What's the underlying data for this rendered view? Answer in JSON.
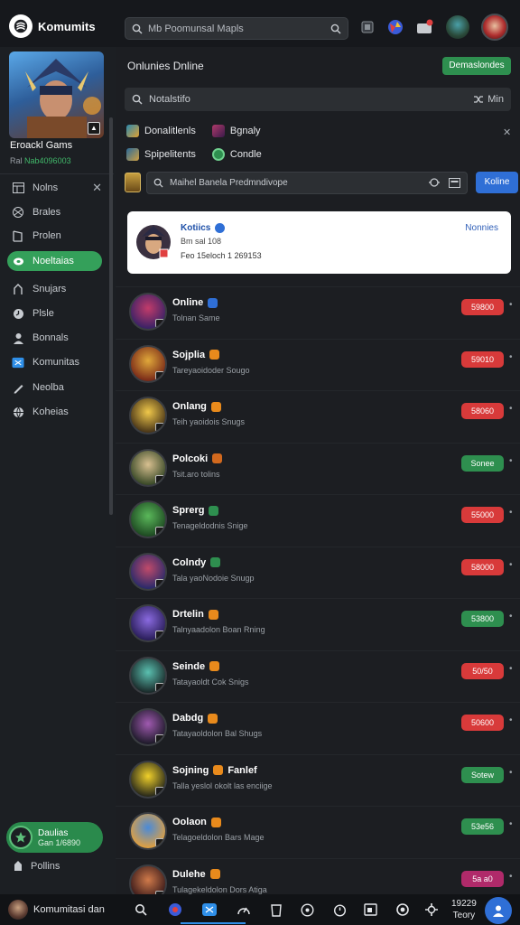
{
  "app": {
    "title": "Komumits"
  },
  "search": {
    "placeholder": "Mb Poomunsal Mapls"
  },
  "sidebar": {
    "hero_name": "Eroackl Gams",
    "hero_sub_prefix": "Ral",
    "hero_sub_value": "Nab4096003",
    "items": [
      {
        "label": "Nolns",
        "icon": "table-icon",
        "active": false
      },
      {
        "label": "Brales",
        "icon": "network-icon",
        "active": false
      },
      {
        "label": "Prolen",
        "icon": "book-icon",
        "active": false
      },
      {
        "label": "Noeltaias",
        "icon": "leaf-icon",
        "active": true
      },
      {
        "label": "Snujars",
        "icon": "person-icon",
        "active": false
      },
      {
        "label": "Plsle",
        "icon": "clock-icon",
        "active": false
      },
      {
        "label": "Bonnals",
        "icon": "user-icon",
        "active": false
      },
      {
        "label": "Komunitas",
        "icon": "message-icon",
        "active": false
      },
      {
        "label": "Neolba",
        "icon": "pen-icon",
        "active": false
      },
      {
        "label": "Koheias",
        "icon": "globe-icon",
        "active": false
      }
    ],
    "friend": {
      "name": "Daulias",
      "sub": "Gan 1/6890"
    },
    "profile_label": "Pollins"
  },
  "main": {
    "title": "Onlunies Dnline",
    "action_button": "Demaslondes",
    "search_placeholder": "Notalstifo",
    "search_right_label": "Min",
    "filters": [
      {
        "left": "Donalitlenls",
        "right": "Bgnaly"
      },
      {
        "left": "Spipelitents",
        "right": "Condle"
      }
    ],
    "map_input_placeholder": "Maihel Banela Predmndivope",
    "map_button": "Koline",
    "profile_card": {
      "name": "Kotiics",
      "line2": "Bm sal 108",
      "line3": "Feo 15eloch 1 269153",
      "link": "Nonnies"
    },
    "rows": [
      {
        "name": "Online",
        "sub": "Tolnan Same",
        "pill": "59800",
        "pill_color": "#d83a3a",
        "badge_color": "#2f6fd6",
        "avatar_colors": [
          "#c23b6a",
          "#3a2266"
        ]
      },
      {
        "name": "Sojplia",
        "sub": "Tareyaoidoder Sougo",
        "pill": "59010",
        "pill_color": "#d83a3a",
        "badge_color": "#e88a1c",
        "avatar_colors": [
          "#e0a83a",
          "#7a2a18"
        ]
      },
      {
        "name": "Onlang",
        "sub": "Teih yaoidois Snugs",
        "pill": "58060",
        "pill_color": "#d83a3a",
        "badge_color": "#e88a1c",
        "avatar_colors": [
          "#f0c84a",
          "#4a3618"
        ]
      },
      {
        "name": "Polcoki",
        "sub": "Tsit.aro tolins",
        "pill": "Sonee",
        "pill_color": "#2e8f4f",
        "badge_color": "#d2691e",
        "avatar_colors": [
          "#d8c090",
          "#3a4a28"
        ]
      },
      {
        "name": "Sprerg",
        "sub": "Tenageldodnis Snige",
        "pill": "55000",
        "pill_color": "#d83a3a",
        "badge_color": "#2e8f4f",
        "avatar_colors": [
          "#5ab85a",
          "#1e4a22"
        ]
      },
      {
        "name": "Colndy",
        "sub": "Tala yaoNodoie Snugp",
        "pill": "58000",
        "pill_color": "#d83a3a",
        "badge_color": "#2e8f4f",
        "avatar_colors": [
          "#c04a6a",
          "#2a2a6a"
        ]
      },
      {
        "name": "Drtelin",
        "sub": "Talnyaadolon Boan Rning",
        "pill": "53800",
        "pill_color": "#2e8f4f",
        "badge_color": "#e88a1c",
        "avatar_colors": [
          "#8a6ae0",
          "#2a1e5a"
        ]
      },
      {
        "name": "Seinde",
        "sub": "Tatayaoldt Cok Snigs",
        "pill": "50/50",
        "pill_color": "#d83a3a",
        "badge_color": "#e88a1c",
        "avatar_colors": [
          "#5ac0b0",
          "#1a2a2a"
        ]
      },
      {
        "name": "Dabdg",
        "sub": "Tatayaoldolon Bal Shugs",
        "pill": "50600",
        "pill_color": "#d83a3a",
        "badge_color": "#e88a1c",
        "avatar_colors": [
          "#a05ab0",
          "#1e1a2a"
        ]
      },
      {
        "name": "Sojning",
        "sub": "Talla yeslol okolt las enciige",
        "pill": "Sotew",
        "pill_color": "#2e8f4f",
        "badge_color": "#e88a1c",
        "extra": "Fanlef",
        "avatar_colors": [
          "#f0d02a",
          "#2a2a1a"
        ]
      },
      {
        "name": "Oolaon",
        "sub": "Telagoeldolon Bars Mage",
        "pill": "53e56",
        "pill_color": "#2e8f4f",
        "badge_color": "#e88a1c",
        "avatar_colors": [
          "#4a8ad8",
          "#e0a040"
        ]
      },
      {
        "name": "Dulehe",
        "sub": "Tulagekeldolon Dors Atiga",
        "pill": "5a a0",
        "pill_color": "#b02a6a",
        "badge_color": "#e88a1c",
        "avatar_colors": [
          "#d07a4a",
          "#3a1a1a"
        ]
      }
    ]
  },
  "taskbar": {
    "app_label": "Komumitasi dan",
    "time": "19229",
    "date": "Teory"
  }
}
